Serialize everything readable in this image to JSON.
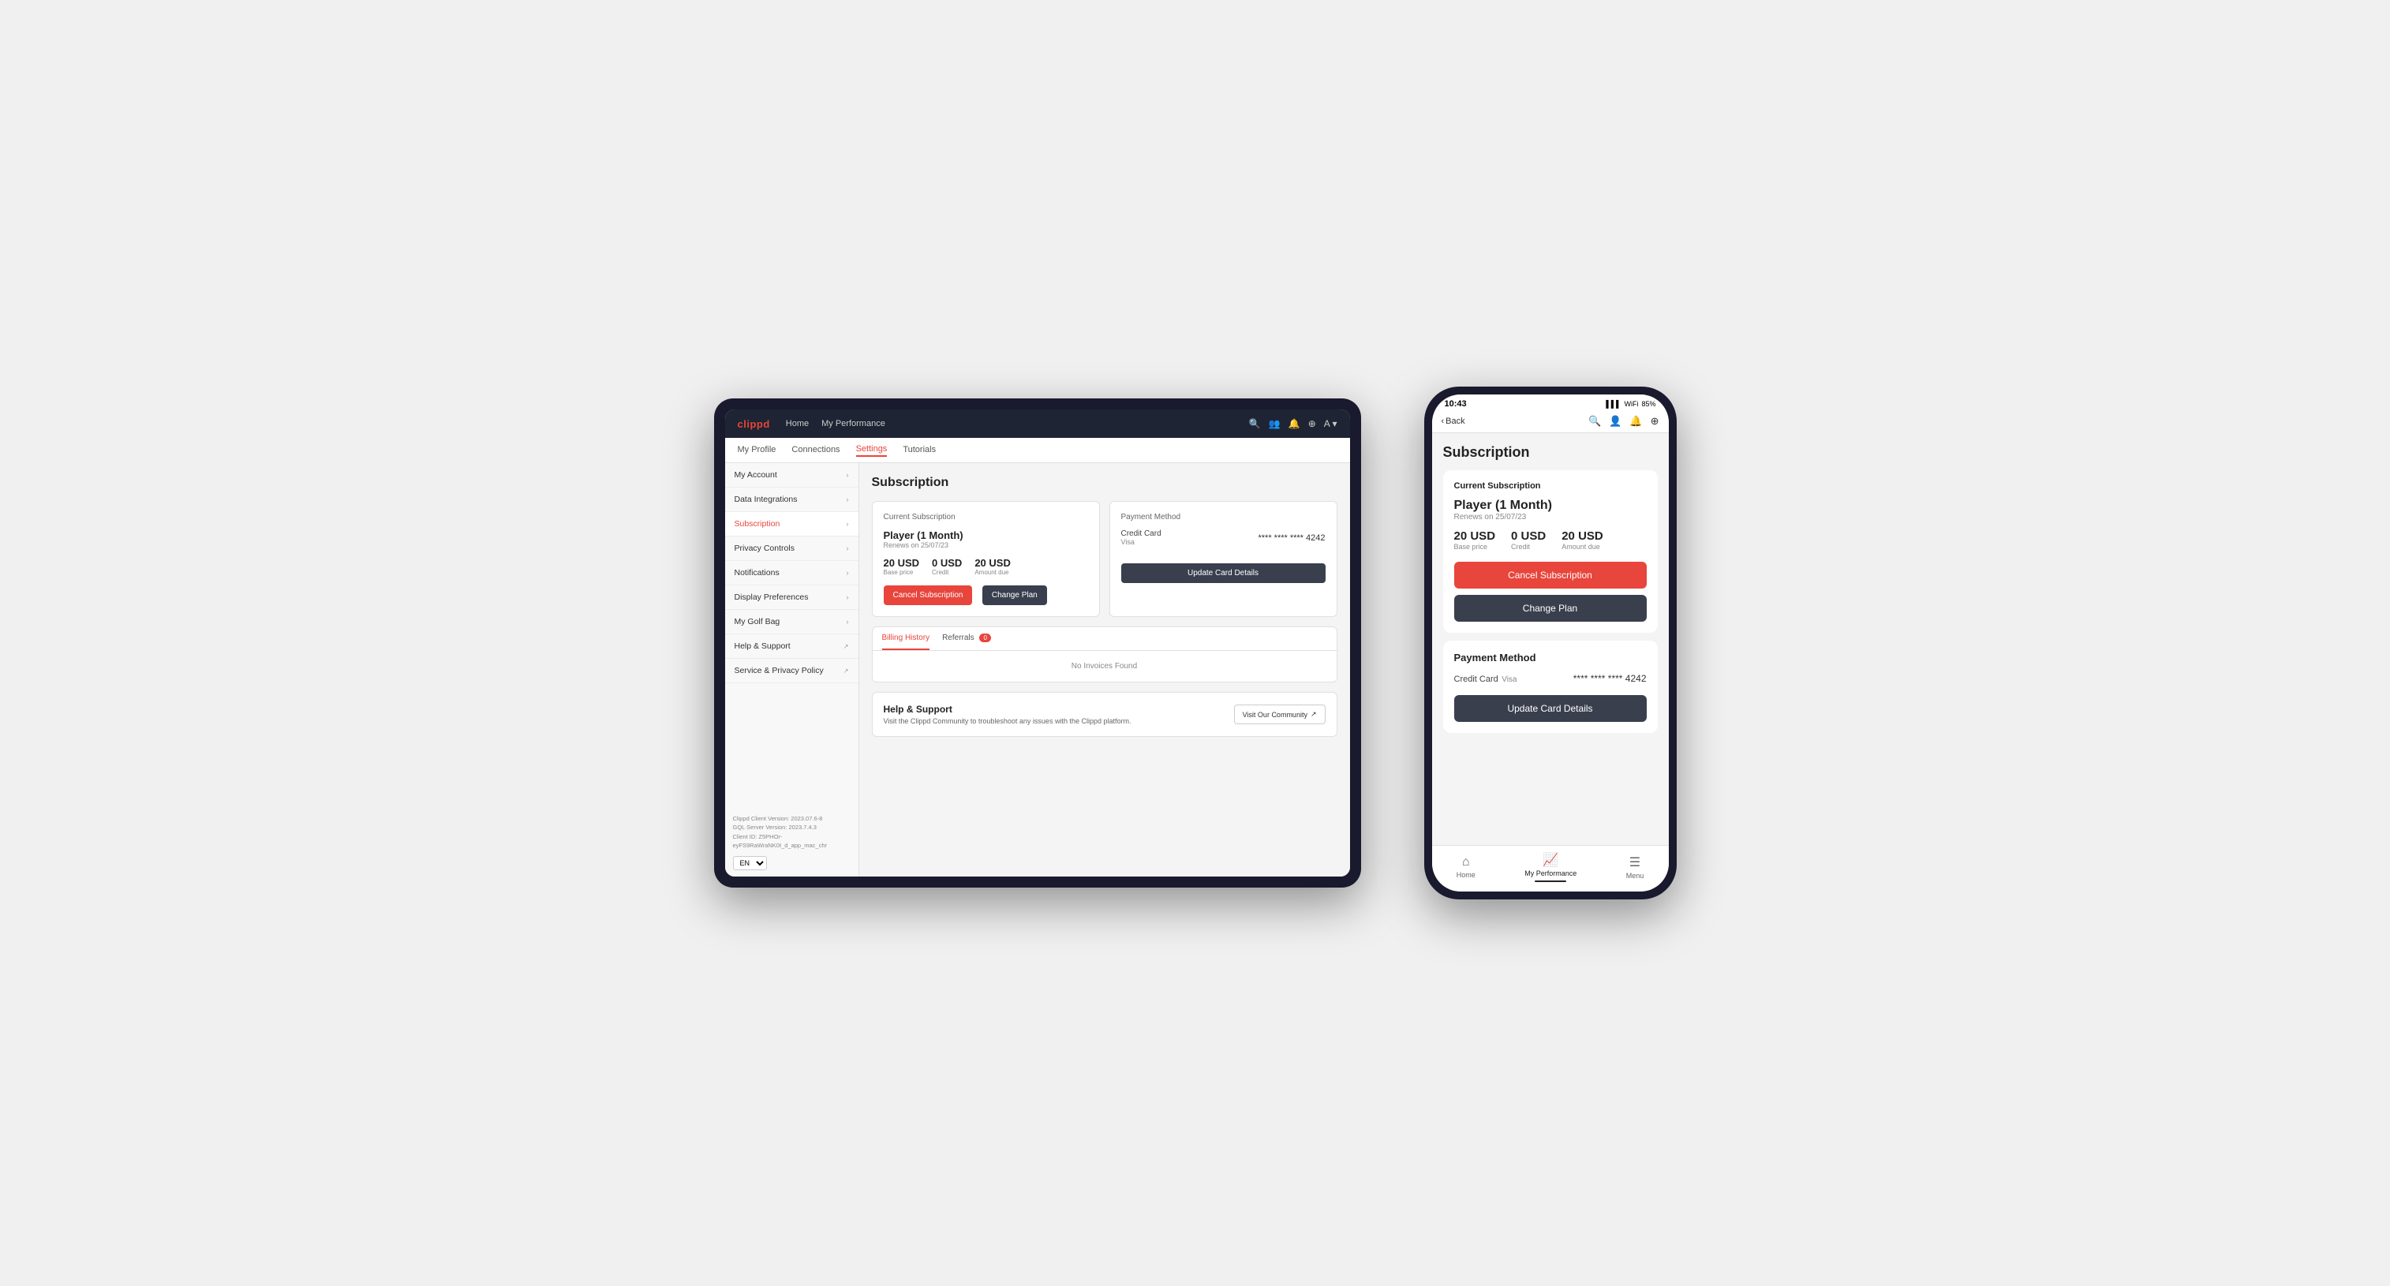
{
  "tablet": {
    "logo": "clippd",
    "nav": {
      "links": [
        "Home",
        "My Performance"
      ],
      "icons": [
        "🔍",
        "👥",
        "🔔",
        "⊕",
        "A"
      ]
    },
    "subnav": {
      "items": [
        "My Profile",
        "Connections",
        "Settings",
        "Tutorials"
      ],
      "active": "Settings"
    },
    "sidebar": {
      "items": [
        {
          "label": "My Account",
          "active": false
        },
        {
          "label": "Data Integrations",
          "active": false
        },
        {
          "label": "Subscription",
          "active": true
        },
        {
          "label": "Privacy Controls",
          "active": false
        },
        {
          "label": "Notifications",
          "active": false
        },
        {
          "label": "Display Preferences",
          "active": false
        },
        {
          "label": "My Golf Bag",
          "active": false
        },
        {
          "label": "Help & Support",
          "active": false
        },
        {
          "label": "Service & Privacy Policy",
          "active": false
        }
      ],
      "footer": {
        "line1": "Clippd Client Version: 2023.07.6-8",
        "line2": "GQL Server Version: 2023.7.4.3",
        "line3": "Client ID: Z5PHOr-eyFS9RaWraNK0t_d_app_mac_chr"
      },
      "lang": "EN"
    },
    "main": {
      "page_title": "Subscription",
      "current_subscription": {
        "section_title": "Current Subscription",
        "plan_name": "Player (1 Month)",
        "renews": "Renews on 25/07/23",
        "base_price": "20 USD",
        "base_label": "Base price",
        "credit": "0 USD",
        "credit_label": "Credit",
        "amount_due": "20 USD",
        "amount_label": "Amount due",
        "btn_cancel": "Cancel Subscription",
        "btn_change": "Change Plan"
      },
      "payment_method": {
        "section_title": "Payment Method",
        "cc_type": "Credit Card",
        "cc_brand": "Visa",
        "cc_number": "**** **** **** 4242",
        "btn_update": "Update Card Details"
      },
      "billing": {
        "tabs": [
          {
            "label": "Billing History",
            "active": true,
            "badge": null
          },
          {
            "label": "Referrals",
            "active": false,
            "badge": "0"
          }
        ],
        "empty_message": "No Invoices Found"
      },
      "help": {
        "title": "Help & Support",
        "description": "Visit the Clippd Community to troubleshoot any issues with the Clippd platform.",
        "btn_community": "Visit Our Community"
      }
    }
  },
  "phone": {
    "status_bar": {
      "time": "10:43",
      "battery": "85"
    },
    "nav": {
      "back_label": "Back",
      "icons": [
        "🔍",
        "👤",
        "🔔",
        "⊕"
      ]
    },
    "page_title": "Subscription",
    "current_subscription": {
      "section_title": "Current Subscription",
      "plan_name": "Player (1 Month)",
      "renews": "Renews on 25/07/23",
      "base_price": "20 USD",
      "base_label": "Base price",
      "credit": "0 USD",
      "credit_label": "Credit",
      "amount_due": "20 USD",
      "amount_label": "Amount due",
      "btn_cancel": "Cancel Subscription",
      "btn_change": "Change Plan"
    },
    "payment_method": {
      "section_title": "Payment Method",
      "cc_type": "Credit Card",
      "cc_brand": "Visa",
      "cc_number": "**** **** **** 4242",
      "btn_update": "Update Card Details"
    },
    "tab_bar": {
      "items": [
        {
          "label": "Home",
          "icon": "⌂",
          "active": false
        },
        {
          "label": "My Performance",
          "icon": "📈",
          "active": true
        },
        {
          "label": "Menu",
          "icon": "☰",
          "active": false
        }
      ]
    }
  }
}
